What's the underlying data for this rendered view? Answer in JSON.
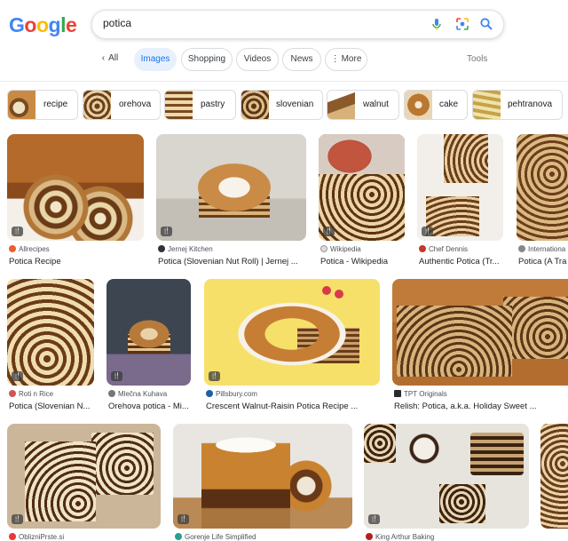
{
  "logo": {
    "letters": [
      "G",
      "o",
      "o",
      "g",
      "l",
      "e"
    ],
    "colors": [
      "#4285F4",
      "#EA4335",
      "#FBBC05",
      "#4285F4",
      "#34A853",
      "#EA4335"
    ]
  },
  "search": {
    "query": "potica",
    "icons": [
      "mic-icon",
      "lens-icon",
      "search-icon"
    ]
  },
  "tabs": [
    {
      "label": "All"
    },
    {
      "label": "Images"
    },
    {
      "label": "Shopping"
    },
    {
      "label": "Videos"
    },
    {
      "label": "News"
    },
    {
      "label": "More"
    }
  ],
  "tools_label": "Tools",
  "chips": [
    {
      "label": "recipe"
    },
    {
      "label": "orehova"
    },
    {
      "label": "pastry"
    },
    {
      "label": "slovenian"
    },
    {
      "label": "walnut"
    },
    {
      "label": "cake"
    },
    {
      "label": "pehtranova"
    }
  ],
  "results": [
    {
      "source": "Allrecipes",
      "title": "Potica Recipe"
    },
    {
      "source": "Jernej Kitchen",
      "title": "Potica (Slovenian Nut Roll) | Jernej ..."
    },
    {
      "source": "Wikipedia",
      "title": "Potica - Wikipedia"
    },
    {
      "source": "Chef Dennis",
      "title": "Authentic Potica (Tr..."
    },
    {
      "source": "Internationa",
      "title": "Potica (A Tra"
    },
    {
      "source": "Roti n Rice",
      "title": "Potica (Slovenian N..."
    },
    {
      "source": "Mlečna Kuhava",
      "title": "Orehova potica - Mi..."
    },
    {
      "source": "Pillsbury.com",
      "title": "Crescent Walnut-Raisin Potica Recipe ..."
    },
    {
      "source": "TPT Originals",
      "title": "Relish: Potica, a.k.a. Holiday Sweet ..."
    },
    {
      "source": "OblizniPrste.si",
      "title": ""
    },
    {
      "source": "Gorenje Life Simplified",
      "title": ""
    },
    {
      "source": "King Arthur Baking",
      "title": ""
    },
    {
      "source": "",
      "title": ""
    }
  ],
  "colors": {
    "accent": "#1a73e8",
    "chip_border": "#dadce0"
  }
}
